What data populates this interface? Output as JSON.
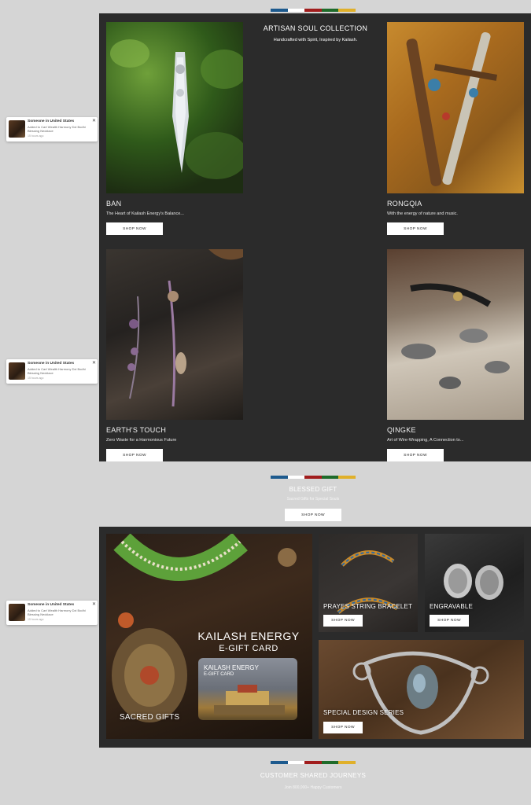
{
  "flag_colors": [
    "#1d5a8e",
    "#ffffff",
    "#a11d1d",
    "#1f6b2a",
    "#e0b02a"
  ],
  "collection": {
    "title": "ARTISAN SOUL COLLECTION",
    "subtitle": "Handcrafted with Spirit, Inspired by Kailash.",
    "items": [
      {
        "title": "BAN",
        "desc": "The Heart of Kailash Energy's Balance...",
        "button": "SHOP NOW"
      },
      {
        "title": "RONGQIA",
        "desc": "With the energy of nature and music.",
        "button": "SHOP NOW"
      },
      {
        "title": "EARTH'S TOUCH",
        "desc": "Zero Waste for a Harmonious Future",
        "button": "SHOP NOW"
      },
      {
        "title": "QINGKE",
        "desc": "Art of Wire-Wrapping, A Connection to...",
        "button": "SHOP NOW"
      }
    ]
  },
  "blessed": {
    "title": "BLESSED GIFT",
    "subtitle": "Sacred Gifts for Special Souls",
    "button": "SHOP NOW"
  },
  "gifts": {
    "sacred_label": "SACRED GIFTS",
    "card_title": "KAILASH  ENERGY",
    "card_subtitle": "E-GIFT CARD",
    "mini_card_title": "KAILASH  ENERGY",
    "mini_card_subtitle": "E-GIFT CARD",
    "prayer_label": "PRAYES STRING BRACELET",
    "prayer_button": "SHOP NOW",
    "engravable_label": "ENGRAVABLE",
    "engravable_button": "SHOP NOW",
    "special_label": "SPECIAL DESIGN SERIES",
    "special_button": "SHOP NOW"
  },
  "journeys": {
    "title": "CUSTOMER SHARED JOURNEYS",
    "subtitle": "Join 800,000+ Happy Customers"
  },
  "toasts": [
    {
      "who": "Someone in United States",
      "what": "Added to Cart Wealth Harmony Dzi Bodhi Blessing Necklace",
      "when": "15 hours ago"
    },
    {
      "who": "Someone in United States",
      "what": "Added to Cart Wealth Harmony Dzi Bodhi Blessing Necklace",
      "when": "15 hours ago"
    },
    {
      "who": "Someone in United States",
      "what": "Added to Cart Wealth Harmony Dzi Bodhi Blessing Necklace",
      "when": "15 hours ago"
    }
  ]
}
